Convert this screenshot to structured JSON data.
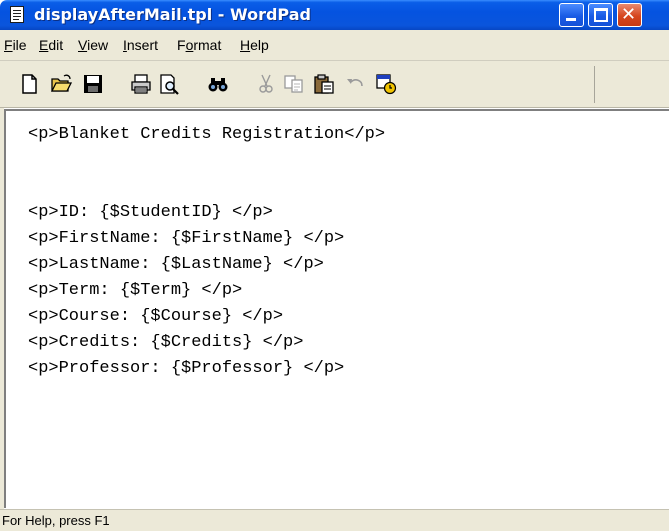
{
  "window": {
    "title": "displayAfterMail.tpl - WordPad"
  },
  "menu": {
    "items": [
      {
        "label": "File"
      },
      {
        "label": "Edit"
      },
      {
        "label": "View"
      },
      {
        "label": "Insert"
      },
      {
        "label": "Format"
      },
      {
        "label": "Help"
      }
    ]
  },
  "toolbar": {
    "buttons": [
      {
        "name": "new-icon"
      },
      {
        "name": "open-icon"
      },
      {
        "name": "save-icon"
      },
      {
        "name": "print-icon"
      },
      {
        "name": "print-preview-icon"
      },
      {
        "name": "find-icon"
      },
      {
        "name": "cut-icon"
      },
      {
        "name": "copy-icon"
      },
      {
        "name": "paste-icon"
      },
      {
        "name": "undo-icon"
      },
      {
        "name": "date-time-icon"
      }
    ]
  },
  "document": {
    "lines": [
      "<p>Blanket Credits Registration</p>",
      "",
      "<p>ID: {$StudentID} </p>",
      "<p>FirstName: {$FirstName} </p>",
      "<p>LastName: {$LastName} </p>",
      "<p>Term: {$Term} </p>",
      "<p>Course: {$Course} </p>",
      "<p>Credits: {$Credits} </p>",
      "<p>Professor: {$Professor} </p>"
    ]
  },
  "statusbar": {
    "text": "For Help, press F1"
  },
  "colors": {
    "titlebar": "#0553e0",
    "chrome": "#ece9d8",
    "close_button": "#d6461f"
  }
}
